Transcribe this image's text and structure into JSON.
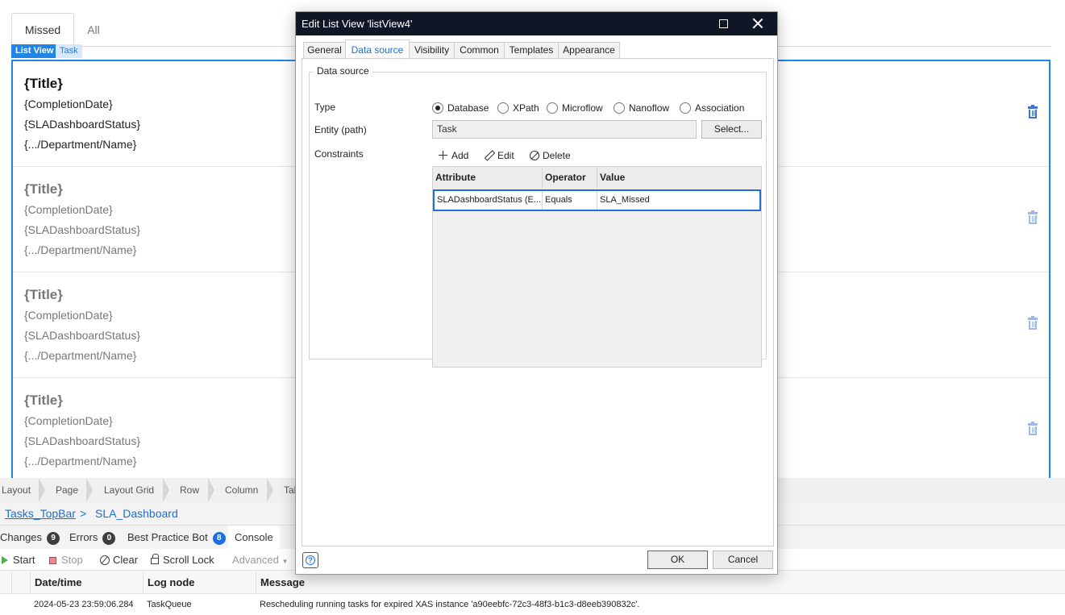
{
  "page": {
    "tabs": [
      "Missed",
      "All"
    ],
    "chips": {
      "listview": "List View",
      "entity": "Task"
    },
    "items": [
      {
        "title": "{Title}",
        "lines": [
          "{CompletionDate}",
          "{SLADashboardStatus}",
          "{.../Department/Name}"
        ]
      },
      {
        "title": "{Title}",
        "lines": [
          "{CompletionDate}",
          "{SLADashboardStatus}",
          "{.../Department/Name}"
        ]
      },
      {
        "title": "{Title}",
        "lines": [
          "{CompletionDate}",
          "{SLADashboardStatus}",
          "{.../Department/Name}"
        ]
      },
      {
        "title": "{Title}",
        "lines": [
          "{CompletionDate}",
          "{SLADashboardStatus}",
          "{.../Department/Name}"
        ]
      }
    ]
  },
  "hierarchy": [
    "Layout",
    "Page",
    "Layout Grid",
    "Row",
    "Column",
    "Tal"
  ],
  "docpath": {
    "link": "Tasks_TopBar",
    "sep": ">",
    "current": "SLA_Dashboard"
  },
  "panel": {
    "tabs": [
      {
        "label": "Changes",
        "count": "9"
      },
      {
        "label": "Errors",
        "count": "0"
      },
      {
        "label": "Best Practice Bot",
        "count": "8"
      },
      {
        "label": "Console",
        "count": ""
      }
    ],
    "console_buttons": {
      "start": "Start",
      "stop": "Stop",
      "clear": "Clear",
      "scroll_lock": "Scroll Lock",
      "advanced": "Advanced"
    },
    "log_columns": [
      "Date/time",
      "Log node",
      "Message"
    ],
    "log_row": {
      "datetime": "2024-05-23 23:59:06.284",
      "node": "TaskQueue",
      "message": "Rescheduling running tasks for expired XAS instance 'a90eebfc-72c3-48f3-b1c3-d8eeb390832c'."
    }
  },
  "dialog": {
    "title": "Edit List View 'listView4'",
    "tabs": [
      "General",
      "Data source",
      "Visibility",
      "Common",
      "Templates",
      "Appearance"
    ],
    "active_tab": "Data source",
    "legend": "Data source",
    "type_label": "Type",
    "type_options": [
      "Database",
      "XPath",
      "Microflow",
      "Nanoflow",
      "Association"
    ],
    "type_selected": "Database",
    "entity_label": "Entity (path)",
    "entity_value": "Task",
    "select_button": "Select...",
    "constraints_label": "Constraints",
    "toolbar": {
      "add": "Add",
      "edit": "Edit",
      "delete": "Delete"
    },
    "grid_columns": [
      "Attribute",
      "Operator",
      "Value"
    ],
    "grid_rows": [
      {
        "attribute": "SLADashboardStatus (E...",
        "operator": "Equals",
        "value": "SLA_Missed"
      }
    ],
    "help_glyph": "?",
    "ok": "OK",
    "cancel": "Cancel"
  },
  "colors": {
    "accent": "#1f86e8",
    "titlebar": "#0f1726",
    "link": "#1a6fd0"
  }
}
